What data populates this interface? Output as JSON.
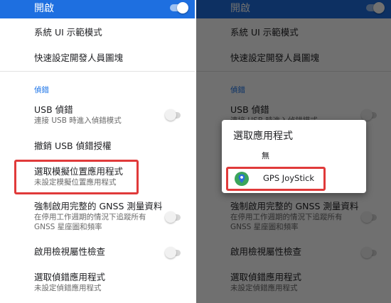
{
  "colors": {
    "accent_blue": "#1e6fe0",
    "section_blue": "#1a73e8",
    "highlight_red": "#e03a3a",
    "dim_overlay": "rgba(0,0,0,0.56)"
  },
  "settings": {
    "master_toggle": {
      "label": "開啟",
      "on": true
    },
    "system_ui_demo": {
      "title": "系統 UI 示範模式"
    },
    "quick_tiles": {
      "title": "快速設定開發人員圖塊"
    },
    "section_debug": "偵錯",
    "usb_debug": {
      "title": "USB 偵錯",
      "subtitle": "連接 USB 時進入偵錯模式",
      "on": false
    },
    "revoke_usb": {
      "title": "撤銷 USB 偵錯授權"
    },
    "mock_location": {
      "title": "選取模擬位置應用程式",
      "subtitle": "未設定模擬位置應用程式"
    },
    "gnss": {
      "title": "強制啟用完整的 GNSS 測量資料",
      "subtitle_line1": "在停用工作週期的情況下追蹤所有",
      "subtitle_line2": "GNSS 星座圖和頻率",
      "on": false
    },
    "view_attr": {
      "title": "啟用檢視屬性檢查",
      "on": false
    },
    "debug_app": {
      "title": "選取偵錯應用程式",
      "subtitle": "未設定偵錯應用程式"
    }
  },
  "dialog": {
    "title": "選取應用程式",
    "none_option": "無",
    "app_option": {
      "name": "GPS JoyStick",
      "icon": "location-pin-icon"
    }
  }
}
